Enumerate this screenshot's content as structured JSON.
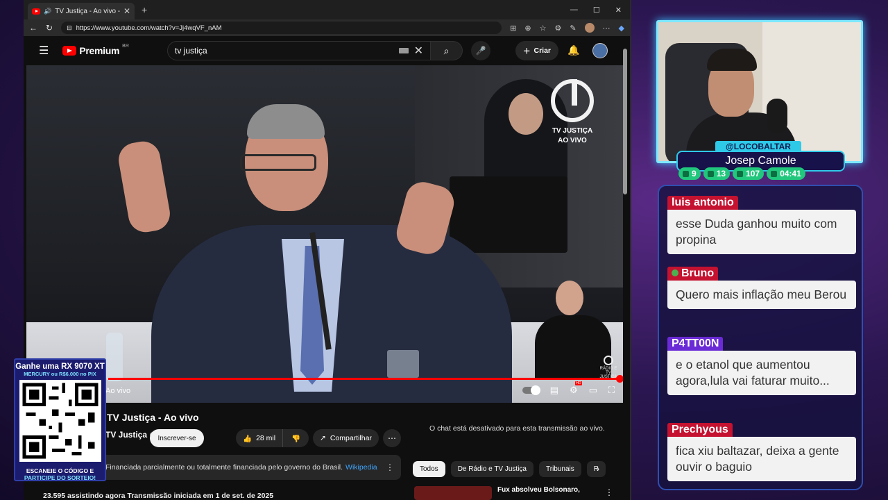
{
  "browser": {
    "tab_title": "TV Justiça - Ao vivo - YouTube",
    "url": "https://www.youtube.com/watch?v=Jj4wqVF_nAM",
    "new_tab": "+",
    "win_min": "—",
    "win_max": "☐",
    "win_close": "✕"
  },
  "youtube": {
    "logo": "Premium",
    "logo_region": "BR",
    "search_value": "tv justiça",
    "create_label": "Criar",
    "video_overlay_logo": "TV JUSTIÇA",
    "video_overlay_live": "AO VIVO",
    "radio_logo": "RÁDIO E TV JUSTIÇA",
    "live_label": "Ao vivo",
    "progress_fraction": 1.0,
    "title": "TV Justiça - Ao vivo",
    "channel": "TV Justiça",
    "subscribe_label": "Inscrever-se",
    "likes": "28 mil",
    "share_label": "Compartilhar",
    "info_text": "Financiada parcialmente ou totalmente financiada pelo governo do Brasil.",
    "info_link": "Wikipedia",
    "views_line": "23.595 assistindo agora  Transmissão iniciada em 1 de set. de 2025",
    "chat_disabled": "O chat está desativado para esta transmissão ao vivo.",
    "chips": [
      "Todos",
      "De Rádio e TV Justiça",
      "Tribunais",
      "R"
    ],
    "rec_title": "Fux absolveu Bolsonaro,"
  },
  "sponsor": {
    "headline": "Ganhe uma RX 9070 XT",
    "subline": "MERCURY ou R$6.000 no PIX",
    "footer1": "ESCANEIE O CÓDIGO E",
    "footer2": "PARTICIPE DO SORTEIO!"
  },
  "streamer": {
    "handle": "@LOCOBALTAR",
    "name": "Josep Camole",
    "stats": [
      {
        "icon": "twitch-icon",
        "value": "9"
      },
      {
        "icon": "youtube-icon",
        "value": "13"
      },
      {
        "icon": "kick-icon",
        "value": "107"
      },
      {
        "icon": "clock-icon",
        "value": "04:41"
      }
    ]
  },
  "chat": [
    {
      "user": "luis antonio",
      "text": "esse Duda ganhou muito com propina",
      "color": "#c41230"
    },
    {
      "user": "Bruno",
      "text": "Quero mais inflação meu Berou",
      "color": "#c41230"
    },
    {
      "user": "P4TT00N",
      "text": "e o etanol que aumentou agora,lula vai faturar muito...",
      "color": "#6a2bd6"
    },
    {
      "user": "Prechyous",
      "text": "fica xiu baltazar, deixa a gente ouvir o baguio",
      "color": "#c41230"
    }
  ]
}
